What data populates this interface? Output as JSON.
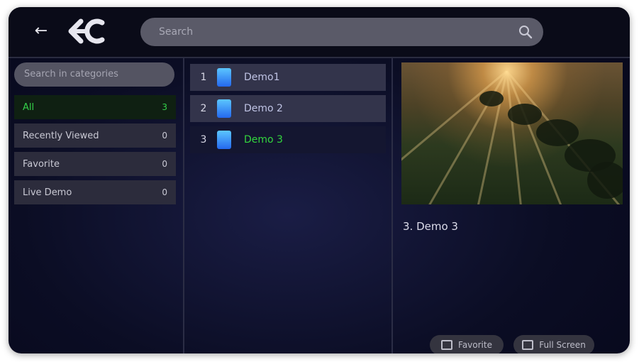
{
  "header": {
    "back_label": "←",
    "search_placeholder": "Search"
  },
  "sidebar": {
    "category_search_placeholder": "Search in categories",
    "categories": [
      {
        "label": "All",
        "count": "3"
      },
      {
        "label": "Recently Viewed",
        "count": "0"
      },
      {
        "label": "Favorite",
        "count": "0"
      },
      {
        "label": "Live Demo",
        "count": "0"
      }
    ]
  },
  "list": {
    "items": [
      {
        "num": "1",
        "name": "Demo1"
      },
      {
        "num": "2",
        "name": "Demo 2"
      },
      {
        "num": "3",
        "name": "Demo 3"
      }
    ],
    "selected_index": 2
  },
  "preview": {
    "title": "3. Demo 3"
  },
  "actions": {
    "first_label": "Favorite",
    "second_label": "Full Screen"
  },
  "colors": {
    "accent_green": "#33d63e",
    "background": "#0b0d24"
  }
}
